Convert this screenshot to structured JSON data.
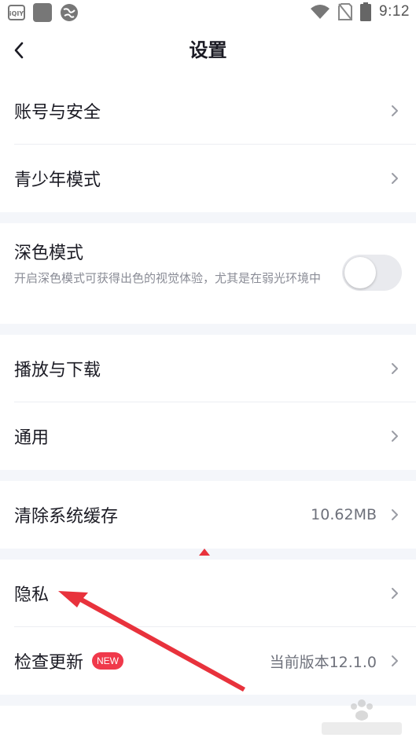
{
  "status_bar": {
    "time": "9:12",
    "icons": [
      "iqiyi-icon",
      "app-square-icon",
      "globe-icon",
      "wifi-icon",
      "no-sim-icon",
      "battery-icon"
    ]
  },
  "header": {
    "title": "设置",
    "back_icon": "chevron-left-icon"
  },
  "sections": {
    "account": {
      "account_security": "账号与安全",
      "teen_mode": "青少年模式"
    },
    "dark_mode": {
      "title": "深色模式",
      "description": "开启深色模式可获得出色的视觉体验，尤其是在弱光环境中",
      "enabled": false
    },
    "playback": {
      "play_download": "播放与下载",
      "general": "通用"
    },
    "cache": {
      "label": "清除系统缓存",
      "value": "10.62MB"
    },
    "misc": {
      "privacy": "隐私",
      "check_update": "检查更新",
      "new_badge": "NEW",
      "version": "当前版本12.1.0"
    }
  },
  "colors": {
    "text": "#1b1b24",
    "secondary_text": "#8a8c96",
    "section_gap": "#f4f6fa",
    "badge": "#f0394b",
    "annotation_arrow": "#e8323c"
  }
}
